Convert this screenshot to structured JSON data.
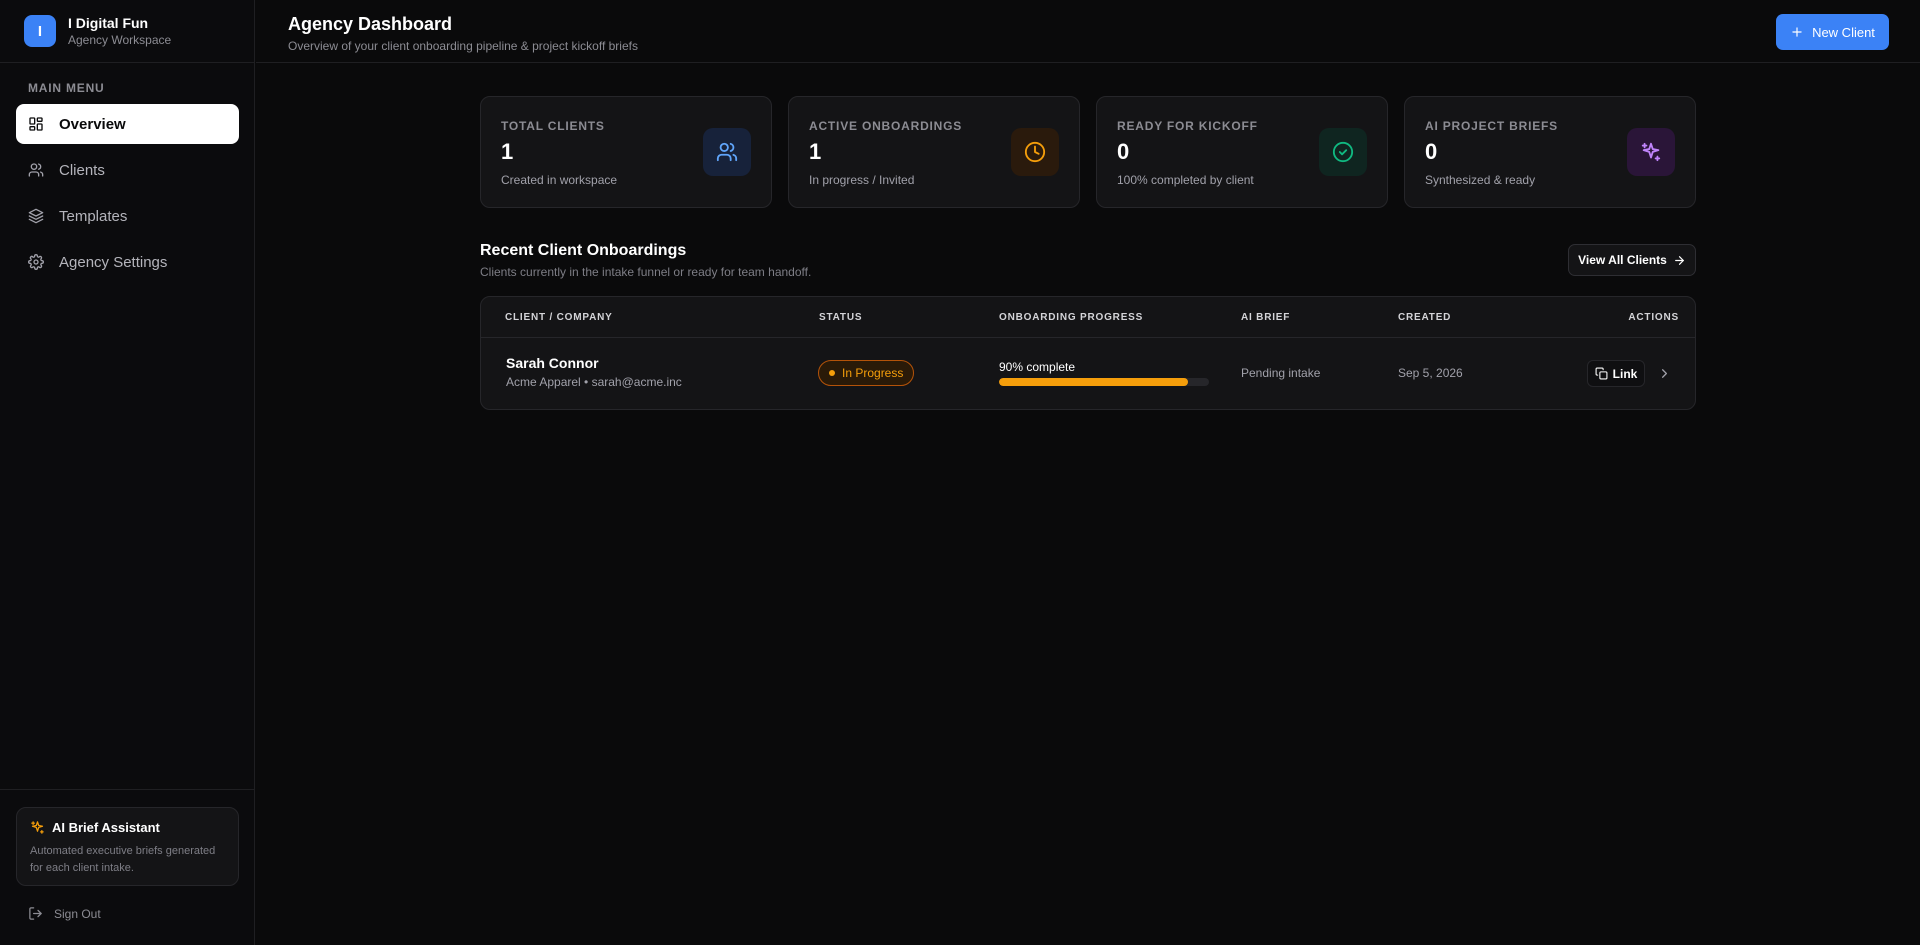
{
  "brand": {
    "logo_letter": "I",
    "title": "I Digital Fun",
    "subtitle": "Agency Workspace"
  },
  "sidebar": {
    "menu_label": "MAIN MENU",
    "items": [
      {
        "label": "Overview",
        "icon": "grid-icon",
        "active": true
      },
      {
        "label": "Clients",
        "icon": "users-icon",
        "active": false
      },
      {
        "label": "Templates",
        "icon": "layers-icon",
        "active": false
      },
      {
        "label": "Agency Settings",
        "icon": "gear-icon",
        "active": false
      }
    ],
    "assistant": {
      "title": "AI Brief Assistant",
      "description": "Automated executive briefs generated for each client intake."
    },
    "signout_label": "Sign Out"
  },
  "header": {
    "title": "Agency Dashboard",
    "subtitle": "Overview of your client onboarding pipeline & project kickoff briefs",
    "new_client_label": "New Client"
  },
  "stats": [
    {
      "label": "TOTAL CLIENTS",
      "value": "1",
      "sub": "Created in workspace",
      "icon": "users-icon",
      "color": "#60a5fa"
    },
    {
      "label": "ACTIVE ONBOARDINGS",
      "value": "1",
      "sub": "In progress / Invited",
      "icon": "clock-icon",
      "color": "#f59e0b"
    },
    {
      "label": "READY FOR KICKOFF",
      "value": "0",
      "sub": "100% completed by client",
      "icon": "check-circle-icon",
      "color": "#10b981"
    },
    {
      "label": "AI PROJECT BRIEFS",
      "value": "0",
      "sub": "Synthesized & ready",
      "icon": "sparkles-icon",
      "color": "#c084fc"
    }
  ],
  "recent": {
    "title": "Recent Client Onboardings",
    "subtitle": "Clients currently in the intake funnel or ready for team handoff.",
    "view_all_label": "View All Clients",
    "columns": [
      "CLIENT / COMPANY",
      "STATUS",
      "ONBOARDING PROGRESS",
      "AI BRIEF",
      "CREATED",
      "ACTIONS"
    ],
    "rows": [
      {
        "name": "Sarah Connor",
        "company": "Acme Apparel",
        "email": "sarah@acme.inc",
        "meta": "Acme Apparel •  sarah@acme.inc",
        "status": "In Progress",
        "progress_text": "90% complete",
        "progress": 90,
        "ai_brief": "Pending intake",
        "created": "Sep 5, 2026",
        "link_label": "Link"
      }
    ]
  }
}
